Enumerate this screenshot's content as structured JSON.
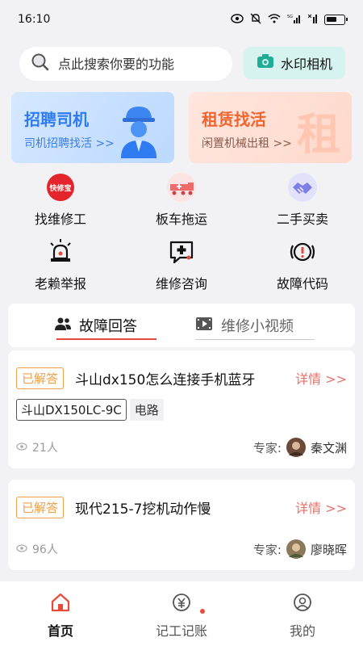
{
  "status_bar": {
    "time": "16:10",
    "signal_text": "5G"
  },
  "search": {
    "placeholder": "点此搜索你要的功能"
  },
  "camera_button": {
    "label": "水印相机"
  },
  "banners": [
    {
      "title": "招聘司机",
      "subtitle": "司机招聘找活 >>"
    },
    {
      "title": "租赁找活",
      "subtitle": "闲置机械出租 >>",
      "badge_char": "租"
    }
  ],
  "services": [
    {
      "label": "找维修工",
      "icon_text": "快修宝"
    },
    {
      "label": "板车拖运"
    },
    {
      "label": "二手买卖"
    },
    {
      "label": "老赖举报"
    },
    {
      "label": "维修咨询"
    },
    {
      "label": "故障代码"
    }
  ],
  "tabs": [
    {
      "label": "故障回答"
    },
    {
      "label": "维修小视频"
    }
  ],
  "qa_items": [
    {
      "badge": "已解答",
      "title": "斗山dx150怎么连接手机蓝牙",
      "detail": "详情 >>",
      "tags": [
        "斗山DX150LC-9C",
        "电路"
      ],
      "views": "21人",
      "expert_label": "专家:",
      "expert_name": "秦文渊"
    },
    {
      "badge": "已解答",
      "title": "现代215-7挖机动作慢",
      "detail": "详情 >>",
      "views": "96人",
      "expert_label": "专家:",
      "expert_name": "廖晓晖"
    }
  ],
  "tabbar": [
    {
      "label": "首页"
    },
    {
      "label": "记工记账"
    },
    {
      "label": "我的"
    }
  ],
  "colors": {
    "accent_red": "#e84b3a",
    "badge_orange": "#f0a04a",
    "detail_red": "#e8706b",
    "blue": "#2f7bf1",
    "orange": "#f0642e"
  }
}
